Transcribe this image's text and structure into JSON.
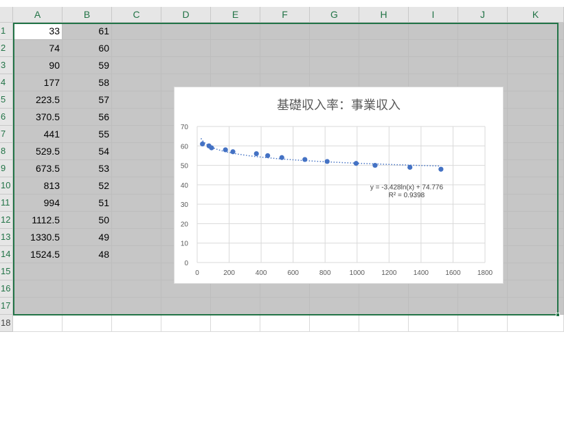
{
  "columns": [
    "A",
    "B",
    "C",
    "D",
    "E",
    "F",
    "G",
    "H",
    "I",
    "J",
    "K"
  ],
  "rows": [
    "1",
    "2",
    "3",
    "4",
    "5",
    "6",
    "7",
    "8",
    "9",
    "10",
    "11",
    "12",
    "13",
    "14",
    "15",
    "16",
    "17",
    "18"
  ],
  "cells": {
    "A": [
      "33",
      "74",
      "90",
      "177",
      "223.5",
      "370.5",
      "441",
      "529.5",
      "673.5",
      "813",
      "994",
      "1112.5",
      "1330.5",
      "1524.5"
    ],
    "B": [
      "61",
      "60",
      "59",
      "58",
      "57",
      "56",
      "55",
      "54",
      "53",
      "52",
      "51",
      "50",
      "49",
      "48"
    ]
  },
  "colors": {
    "accent": "#217346",
    "marker": "#4472c4",
    "selection_fill": "#c6c6c6"
  },
  "chart_data": {
    "type": "scatter",
    "title": "基礎収入率：事業収入",
    "x": [
      33,
      74,
      90,
      177,
      223.5,
      370.5,
      441,
      529.5,
      673.5,
      813,
      994,
      1112.5,
      1330.5,
      1524.5
    ],
    "y": [
      61,
      60,
      59,
      58,
      57,
      56,
      55,
      54,
      53,
      52,
      51,
      50,
      49,
      48
    ],
    "xlim": [
      0,
      1800
    ],
    "ylim": [
      0,
      70
    ],
    "xticks": [
      "0",
      "200",
      "400",
      "600",
      "800",
      "1000",
      "1200",
      "1400",
      "1600",
      "1800"
    ],
    "yticks": [
      "0",
      "10",
      "20",
      "30",
      "40",
      "50",
      "60",
      "70"
    ],
    "grid": true,
    "trendline": {
      "type": "logarithmic",
      "a": -3.428,
      "b": 74.776
    },
    "equation": "y = -3.428ln(x) + 74.776",
    "r2": "R² = 0.9398"
  }
}
